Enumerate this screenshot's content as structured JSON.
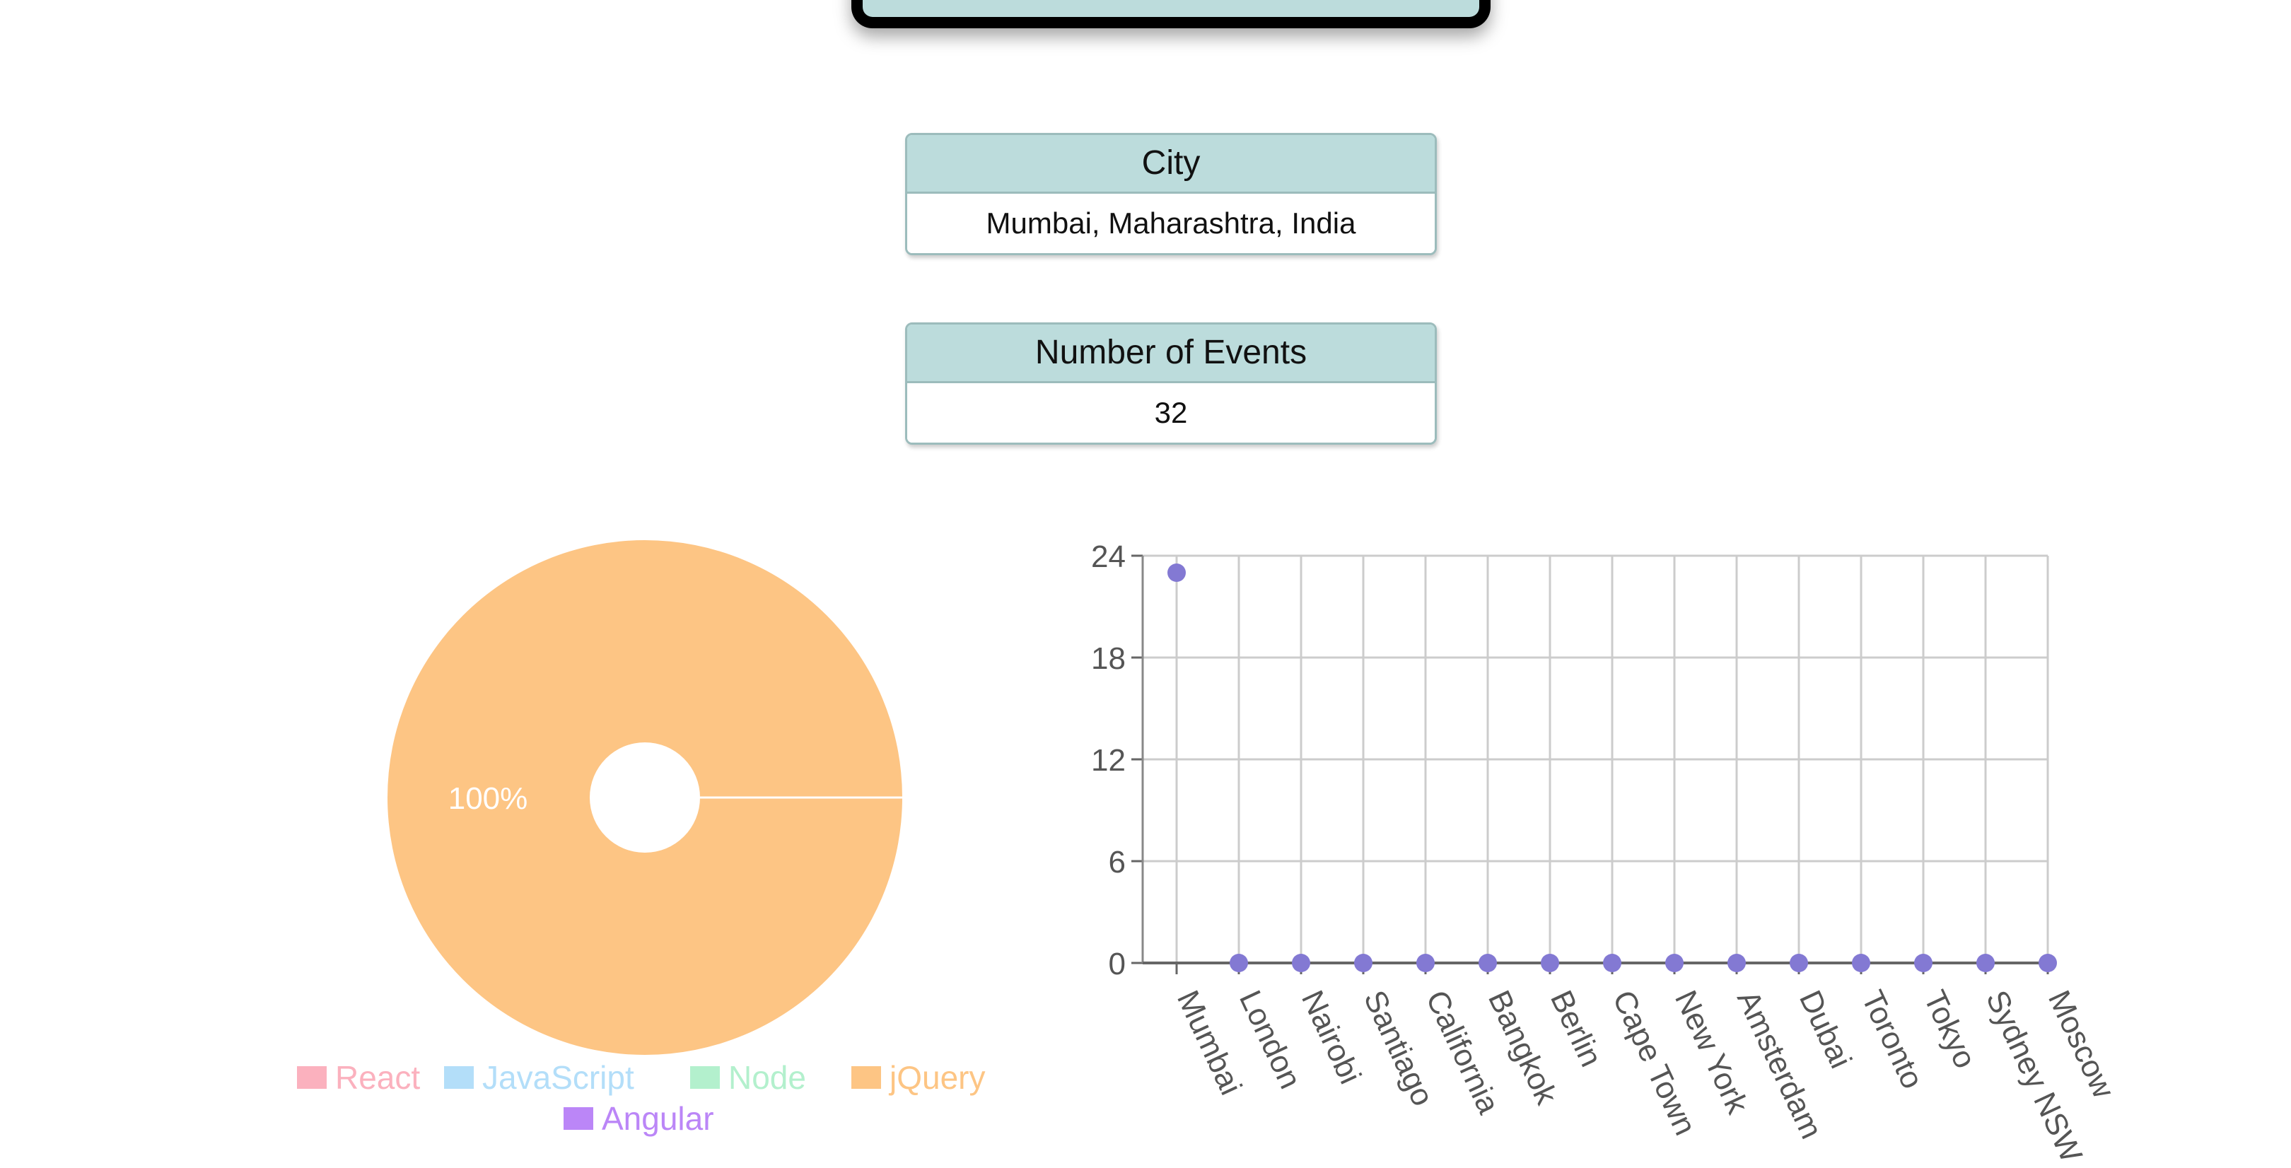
{
  "colors": {
    "card_header_bg": "#bcdcdc",
    "card_border": "#9cbcbc",
    "pie_react": "#fbb1be",
    "pie_javascript": "#b3def9",
    "pie_node": "#b3f0cd",
    "pie_jquery": "#fdc584",
    "pie_angular": "#bb86f7",
    "scatter_point": "#8379d3"
  },
  "city_card": {
    "label": "City",
    "value": "Mumbai, Maharashtra, India"
  },
  "events_card": {
    "label": "Number of Events",
    "value": "32"
  },
  "chart_data": [
    {
      "type": "pie",
      "categories": [
        "React",
        "JavaScript",
        "Node",
        "jQuery",
        "Angular"
      ],
      "values": [
        0,
        0,
        0,
        100,
        0
      ],
      "colors": [
        "#fbb1be",
        "#b3def9",
        "#b3f0cd",
        "#fdc584",
        "#bb86f7"
      ],
      "data_labels": [
        "",
        "",
        "",
        "100%",
        ""
      ],
      "donut": true,
      "legend_position": "bottom",
      "title": ""
    },
    {
      "type": "scatter",
      "categories": [
        "Mumbai",
        "London",
        "Nairobi",
        "Santiago",
        "California",
        "Bangkok",
        "Berlin",
        "Cape Town",
        "New York",
        "Amsterdam",
        "Dubai",
        "Toronto",
        "Tokyo",
        "Sydney NSW",
        "Moscow"
      ],
      "values": [
        23,
        0,
        0,
        0,
        0,
        0,
        0,
        0,
        0,
        0,
        0,
        0,
        0,
        0,
        0
      ],
      "ylim": [
        0,
        24
      ],
      "yticks": [
        0,
        6,
        12,
        18,
        24
      ],
      "grid": true,
      "xlabel": "",
      "ylabel": "",
      "title": ""
    }
  ]
}
